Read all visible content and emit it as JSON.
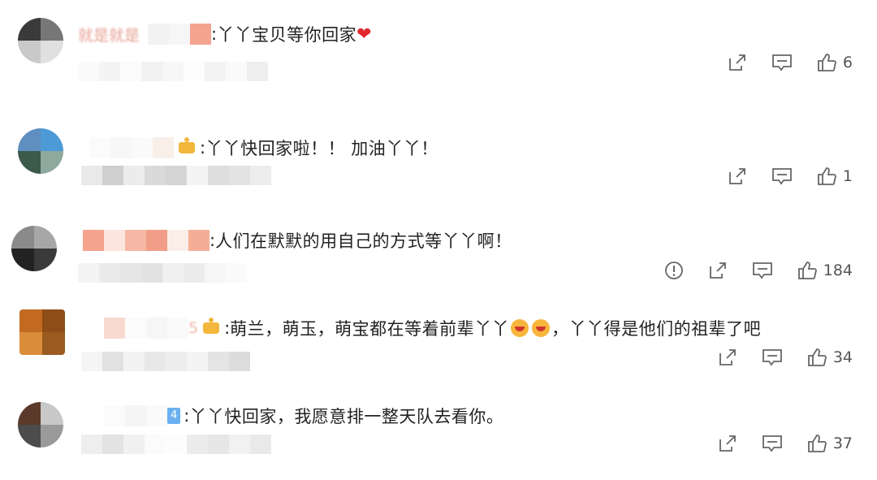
{
  "colors": {
    "heart": "#e0282e",
    "icon": "#666666",
    "count": "#555555"
  },
  "comments": [
    {
      "id": "c1",
      "name_blur": "就是就是",
      "separator": ":",
      "text": "丫丫宝贝等你回家",
      "suffix_icon": "heart-icon",
      "likes": "6"
    },
    {
      "id": "c2",
      "separator": ":",
      "text": "丫丫快回家啦！！ 加油丫丫！",
      "badge_icon": "crown-icon",
      "likes": "1"
    },
    {
      "id": "c3",
      "separator": ":",
      "text": "人们在默默的用自己的方式等丫丫啊！",
      "likes": "184",
      "has_report": true
    },
    {
      "id": "c4",
      "name_tail": "5",
      "separator": ":",
      "text_a": "萌兰，萌玉，萌宝都在等着前辈丫丫",
      "text_b": "，丫丫得是他们的祖辈了吧",
      "badge_icon": "crown-icon",
      "likes": "34"
    },
    {
      "id": "c5",
      "verified": "4",
      "separator": ":",
      "text": "丫丫快回家，我愿意排一整天队去看你。",
      "likes": "37"
    }
  ]
}
